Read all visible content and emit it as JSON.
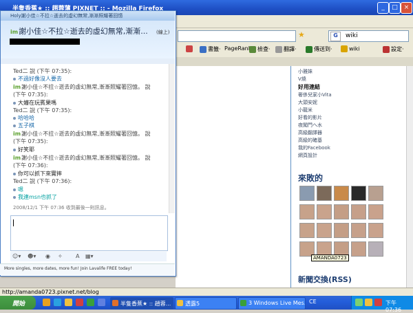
{
  "firefox": {
    "title": "半隻香蕉★ :: 趙蓉薄 PIXNET :: - Mozilla Firefox",
    "search_value": "wiki",
    "toolbar_items": [
      "書籤·",
      "PageRank",
      "檢查·",
      "翻譯·",
      "傳送到·",
      "wiki",
      "設定·"
    ],
    "status_url": "http://amanda0723.pixnet.net/blog"
  },
  "blog": {
    "sidebar_links": [
      "小雅妹",
      "V燒",
      "奢侈兒家小Vita",
      "大頭安妮",
      "小龍米",
      "好看的影片",
      "夜闖門へ水",
      "高級翻譯器",
      "高級的確基",
      "我的Facebook",
      "網頁設計"
    ],
    "sidebar_bold": "好用連結",
    "friends_title": "來敗的",
    "tooltip": "AMANDA0723",
    "news_title": "新聞交換(RSS)"
  },
  "chat": {
    "window_title": "Holy謝小佳☆不拉☆逝去的虛幻無常,漸漸照耀著回憶",
    "contact_name": "謝小佳☆不拉☆逝去的虛幻無常,漸漸...",
    "contact_status": "(線上)",
    "messages": [
      {
        "kind": "speaker",
        "text": "Ted二 說 (下午 07:35):"
      },
      {
        "kind": "line",
        "text": "不過好像沒人要去"
      },
      {
        "kind": "speaker",
        "text": "謝小佳☆不拉☆逝去的虛幻無常,漸漸照耀著回憶。 說"
      },
      {
        "kind": "speaker",
        "text": "(下午 07:35):"
      },
      {
        "kind": "line",
        "text": "大嬸在玩賓果嗎"
      },
      {
        "kind": "speaker",
        "text": "Ted二 說 (下午 07:35):"
      },
      {
        "kind": "line",
        "text": "哈哈哈"
      },
      {
        "kind": "line",
        "text": "五子棋"
      },
      {
        "kind": "speaker",
        "text": "謝小佳☆不拉☆逝去的虛幻無常,漸漸照耀著回憶。 說"
      },
      {
        "kind": "speaker",
        "text": "(下午 07:35):"
      },
      {
        "kind": "line",
        "text": "好笑耶"
      },
      {
        "kind": "speaker",
        "text": "謝小佳☆不拉☆逝去的虛幻無常,漸漸照耀著回憶。 說"
      },
      {
        "kind": "speaker",
        "text": "(下午 07:36):"
      },
      {
        "kind": "line",
        "text": "你可以抓下來實摔"
      },
      {
        "kind": "speaker",
        "text": "Ted二 說 (下午 07:36):"
      },
      {
        "kind": "line",
        "text": "嗯"
      },
      {
        "kind": "line",
        "text": "我連msn也抓了"
      }
    ],
    "last_received": "2008/12/1 下午 07:36 收到最後一則訊息。",
    "ad_text": "More singles, more dates, more fun! Join Lavalife FREE today!"
  },
  "taskbar": {
    "start_label": "開始",
    "buttons": [
      "半隻香蕉★ :: 趙蓉...",
      "透露5",
      "3 Windows Live Mes..."
    ],
    "ime": "CE",
    "clock": "下午 07:36"
  }
}
